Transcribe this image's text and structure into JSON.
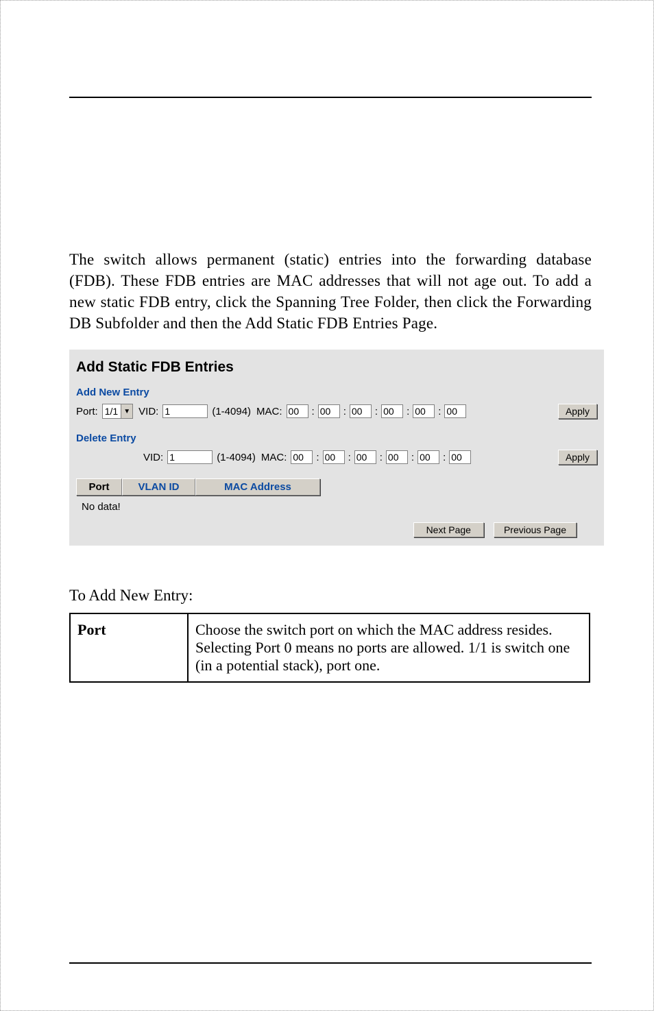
{
  "body_paragraph": "The switch allows permanent (static) entries into the forwarding database (FDB).  These FDB entries are MAC addresses that will not age out. To add a new static FDB entry, click the Spanning Tree Folder, then click the Forwarding DB Subfolder and then the Add Static FDB Entries Page.",
  "panel": {
    "title": "Add Static FDB Entries",
    "add_section": "Add New Entry",
    "delete_section": "Delete Entry",
    "port_label": "Port:",
    "port_value": "1/1",
    "vid_label": "VID:",
    "vid_value": "1",
    "vid_range": "(1-4094)",
    "mac_label": "MAC:",
    "mac": [
      "00",
      "00",
      "00",
      "00",
      "00",
      "00"
    ],
    "apply": "Apply",
    "headers": {
      "port": "Port",
      "vlan": "VLAN ID",
      "mac": "MAC Address"
    },
    "nodata": "No data!",
    "next": "Next Page",
    "prev": "Previous Page"
  },
  "caption": "To Add New Entry:",
  "table": {
    "row1_label": "Port",
    "row1_text": "Choose the switch port on which the MAC address resides. Selecting Port 0 means no ports are allowed. 1/1 is switch one (in a potential stack), port one."
  }
}
